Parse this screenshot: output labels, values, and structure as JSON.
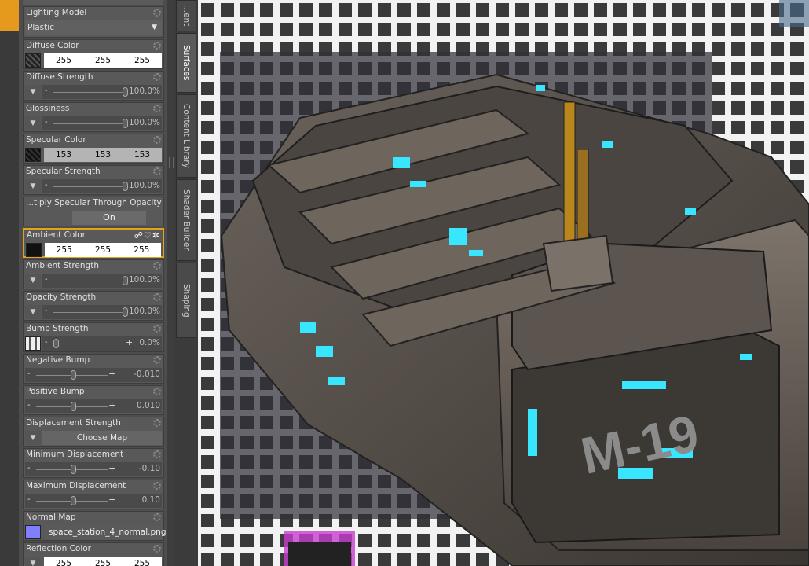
{
  "tabs": [
    "...ent",
    "Surfaces",
    "Content Library",
    "Shader Builder",
    "Shaping"
  ],
  "properties": {
    "lighting_model": {
      "label": "Lighting Model",
      "value": "Plastic"
    },
    "diffuse_color": {
      "label": "Diffuse Color",
      "r": "255",
      "g": "255",
      "b": "255"
    },
    "diffuse_strength": {
      "label": "Diffuse Strength",
      "value": "100.0%",
      "level": 1.0
    },
    "glossiness": {
      "label": "Glossiness",
      "value": "100.0%",
      "level": 1.0
    },
    "specular_color": {
      "label": "Specular Color",
      "r": "153",
      "g": "153",
      "b": "153"
    },
    "specular_strength": {
      "label": "Specular Strength",
      "value": "100.0%",
      "level": 1.0
    },
    "multiply_specular": {
      "label": "...tiply Specular Through Opacity",
      "value": "On"
    },
    "ambient_color": {
      "label": "Ambient Color",
      "r": "255",
      "g": "255",
      "b": "255"
    },
    "ambient_strength": {
      "label": "Ambient Strength",
      "value": "100.0%",
      "level": 1.0
    },
    "opacity_strength": {
      "label": "Opacity Strength",
      "value": "100.0%",
      "level": 1.0
    },
    "bump_strength": {
      "label": "Bump Strength",
      "value": "0.0%",
      "level": 0.0
    },
    "negative_bump": {
      "label": "Negative Bump",
      "value": "-0.010",
      "level": 0.5
    },
    "positive_bump": {
      "label": "Positive Bump",
      "value": "0.010",
      "level": 0.5
    },
    "displacement_strength": {
      "label": "Displacement Strength",
      "button": "Choose Map"
    },
    "minimum_displacement": {
      "label": "Minimum Displacement",
      "value": "-0.10",
      "level": 0.5
    },
    "maximum_displacement": {
      "label": "Maximum Displacement",
      "value": "0.10",
      "level": 0.5
    },
    "normal_map": {
      "label": "Normal Map",
      "file": "space_station_4_normal.png"
    },
    "reflection_color": {
      "label": "Reflection Color",
      "r": "255",
      "g": "255",
      "b": "255"
    }
  },
  "viewport": {
    "model_label": "M-19"
  },
  "colors": {
    "accent": "#e3a319",
    "glow": "#38e6ff",
    "normal_swatch": "#8080ff"
  }
}
